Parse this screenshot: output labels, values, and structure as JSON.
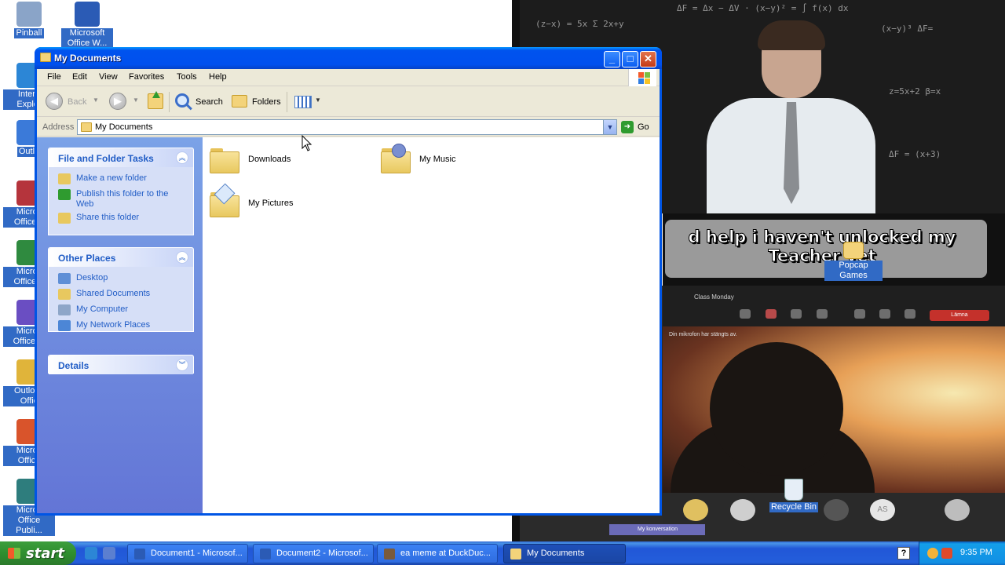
{
  "desktop": {
    "icons_left": [
      {
        "label": "Pinball",
        "name": "desktop-icon-pinball",
        "color": "#8aa4c8"
      },
      {
        "label": "Microsoft Office W...",
        "name": "desktop-icon-word",
        "color": "#2b5bb5"
      },
      {
        "label": "Intern Explor",
        "name": "desktop-icon-internet-explorer",
        "color": "#2c86d6"
      },
      {
        "label": "Outlo",
        "name": "desktop-icon-outlook",
        "color": "#3b7ad9"
      },
      {
        "label": "Micros Office A",
        "name": "desktop-icon-access",
        "color": "#b5343c"
      },
      {
        "label": "Micros Office E",
        "name": "desktop-icon-excel",
        "color": "#2f8a3f"
      },
      {
        "label": "Micros Office In",
        "name": "desktop-icon-infopath",
        "color": "#6a4ec2"
      },
      {
        "label": "Outlook Offic",
        "name": "desktop-icon-outlook-2",
        "color": "#e0b43a"
      },
      {
        "label": "Micros Office",
        "name": "desktop-icon-powerpoint",
        "color": "#d9542b"
      },
      {
        "label": "Micros Office Publi...",
        "name": "desktop-icon-publisher",
        "color": "#2e7d7d"
      }
    ],
    "popcap_label": "Popcap Games",
    "recycle_label": "Recycle Bin",
    "meme_text": "d help i haven't unlocked my Teacher yet",
    "video_title": "Class Monday",
    "video_leave": "Lämna",
    "video_message": "Din mikrofon har stängts av.",
    "video_tab": "My konversation",
    "avatar_text": "AS"
  },
  "window": {
    "title": "My Documents",
    "menu": [
      "File",
      "Edit",
      "View",
      "Favorites",
      "Tools",
      "Help"
    ],
    "toolbar": {
      "back": "Back",
      "search": "Search",
      "folders": "Folders"
    },
    "address": {
      "label": "Address",
      "value": "My Documents",
      "go": "Go"
    },
    "task_panes": [
      {
        "title": "File and Folder Tasks",
        "collapse_glyph": "︽",
        "items": [
          {
            "label": "Make a new folder",
            "icon": "new-folder-icon",
            "color": "#e8c85f"
          },
          {
            "label": "Publish this folder to the Web",
            "icon": "publish-web-icon",
            "color": "#2f9b2f"
          },
          {
            "label": "Share this folder",
            "icon": "share-folder-icon",
            "color": "#e8c85f"
          }
        ]
      },
      {
        "title": "Other Places",
        "collapse_glyph": "︽",
        "items": [
          {
            "label": "Desktop",
            "icon": "desktop-icon",
            "color": "#5f8fd6"
          },
          {
            "label": "Shared Documents",
            "icon": "folder-icon",
            "color": "#e8c85f"
          },
          {
            "label": "My Computer",
            "icon": "computer-icon",
            "color": "#8ea6c8"
          },
          {
            "label": "My Network Places",
            "icon": "network-icon",
            "color": "#4c86d6"
          }
        ]
      },
      {
        "title": "Details",
        "collapse_glyph": "︾",
        "items": []
      }
    ],
    "files": [
      {
        "name": "Downloads",
        "kind": "folder"
      },
      {
        "name": "My Music",
        "kind": "music-folder"
      },
      {
        "name": "My Pictures",
        "kind": "pictures-folder"
      }
    ]
  },
  "taskbar": {
    "start_label": "start",
    "buttons": [
      {
        "label": "Document1 - Microsof...",
        "icon_color": "#2b5bb5",
        "active": false
      },
      {
        "label": "Document2 - Microsof...",
        "icon_color": "#2b5bb5",
        "active": false
      },
      {
        "label": "ea meme at DuckDuc...",
        "icon_color": "#7a5a3a",
        "active": false
      },
      {
        "label": "My Documents",
        "icon_color": "#f3d37a",
        "active": true
      }
    ],
    "clock": "9:35 PM"
  },
  "colors": {
    "title_blue": "#0053ee",
    "task_link": "#215dc6",
    "taskbar_blue": "#245edb",
    "start_green": "#2f8f2f"
  }
}
